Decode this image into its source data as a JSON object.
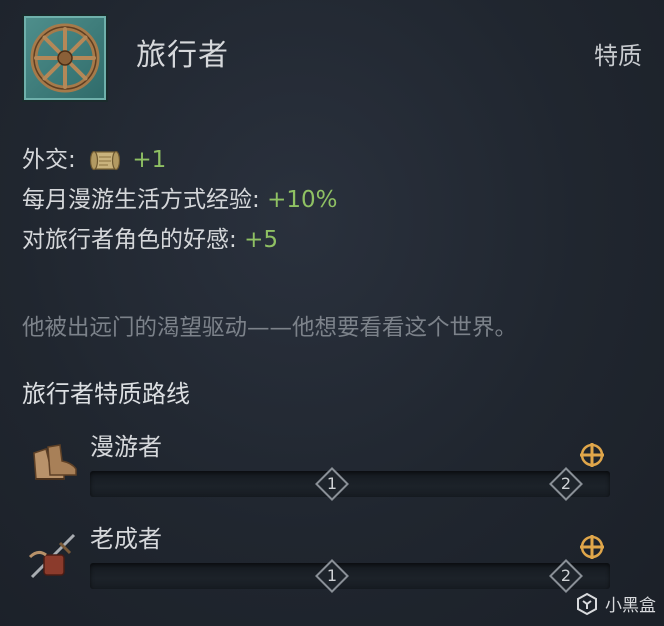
{
  "header": {
    "icon": "wagon-wheel-icon",
    "title": "旅行者",
    "type_label": "特质"
  },
  "modifiers": [
    {
      "label": "外交:",
      "icon": "scroll-icon",
      "value": "+1"
    },
    {
      "label": "每月漫游生活方式经验:",
      "value": "+10%"
    },
    {
      "label": "对旅行者角色的好感:",
      "value": "+5"
    }
  ],
  "description": "他被出远门的渴望驱动——他想要看看这个世界。",
  "track_section": {
    "title": "旅行者特质路线",
    "tracks": [
      {
        "name": "漫游者",
        "icon": "boots-icon",
        "marker_1": "1",
        "marker_2": "2",
        "progress": 0
      },
      {
        "name": "老成者",
        "icon": "sword-and-pack-icon",
        "marker_1": "1",
        "marker_2": "2",
        "progress": 0
      }
    ]
  },
  "watermark": {
    "text": "小黑盒",
    "icon": "xiaoheihe-logo-icon"
  },
  "colors": {
    "positive_value": "#8fc163",
    "description_text": "#7c828a",
    "plus_icon": "#e0a64a"
  }
}
